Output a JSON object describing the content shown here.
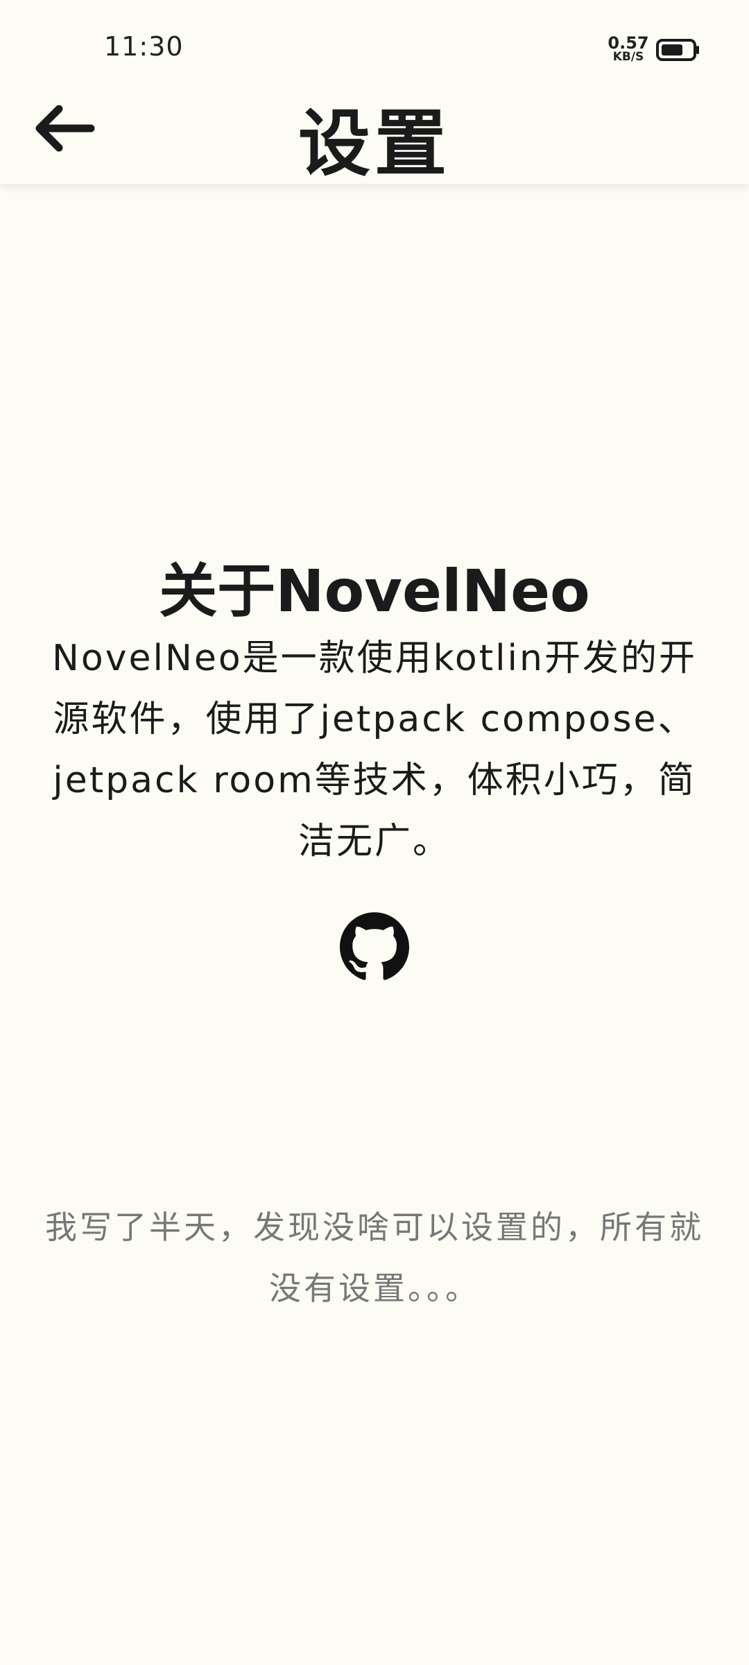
{
  "status_bar": {
    "time": "11:30",
    "net_speed_value": "0.57",
    "net_speed_unit": "KB/S",
    "battery_icon": "battery-icon"
  },
  "app_bar": {
    "back_icon": "arrow-left-icon",
    "title": "设置"
  },
  "about": {
    "title": "关于NovelNeo",
    "description": "NovelNeo是一款使用kotlin开发的开源软件，使用了jetpack compose、jetpack room等技术，体积小巧，简洁无广。",
    "github_icon": "github-icon"
  },
  "note": "我写了半天，发现没啥可以设置的，所有就没有设置。。。",
  "colors": {
    "background": "#FCFBF4",
    "text_primary": "#1B1B1B",
    "text_secondary": "#777777"
  }
}
